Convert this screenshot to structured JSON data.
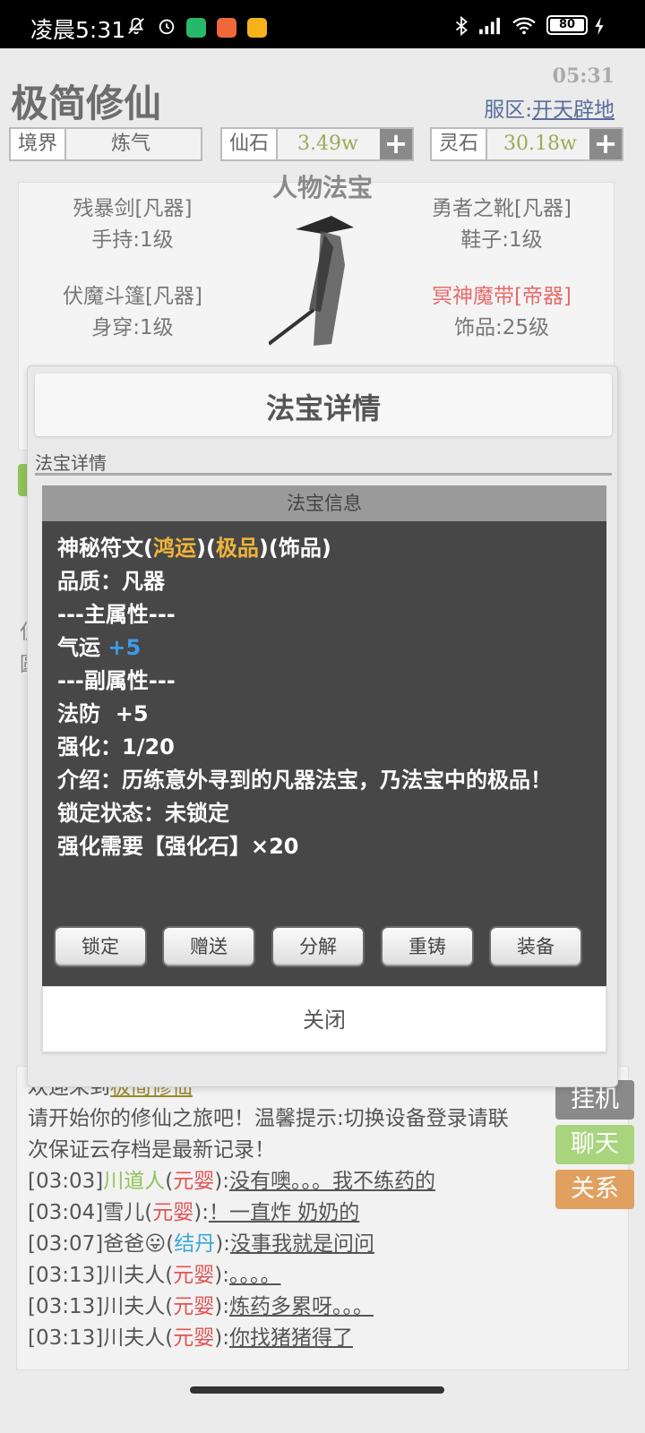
{
  "status_bar": {
    "time": "凌晨5:31",
    "battery": "80"
  },
  "header": {
    "app_title": "极简修仙",
    "clock": "05:31",
    "server_label": "服区:",
    "server_name": "开天辟地"
  },
  "stats": [
    {
      "label": "境界",
      "value": "炼气",
      "value_color": "#666666"
    },
    {
      "label": "仙石",
      "value": "3.49w",
      "value_color": "#a0a85a"
    },
    {
      "label": "灵石",
      "value": "30.18w",
      "value_color": "#a0a85a"
    }
  ],
  "equipment": {
    "title": "人物法宝",
    "slots": [
      {
        "name": "残暴剑[凡器]",
        "detail": "手持:1级"
      },
      {
        "name": "勇者之靴[凡器]",
        "detail": "鞋子:1级"
      },
      {
        "name": "伏魔斗篷[凡器]",
        "detail": "身穿:1级"
      },
      {
        "name": "冥神魔带[帝器]",
        "detail": "饰品:25级"
      }
    ],
    "bg_fragment_1": "仅",
    "bg_fragment_2": "圆"
  },
  "modal": {
    "title": "法宝详情",
    "subtitle": "法宝详情",
    "info_header": "法宝信息",
    "item": {
      "name": "神秘符文(",
      "tag1": "鸿运",
      "sep1": ")(",
      "tag2": "极品",
      "rest": ")(饰品)",
      "quality": "品质：凡器",
      "main_attr_header": "---主属性---",
      "main_attr_name": "气运",
      "main_attr_value": "+5",
      "sub_attr_header": "---副属性---",
      "sub_attr": "法防  +5",
      "enhance": "强化：1/20",
      "intro": "介绍：历练意外寻到的凡器法宝，乃法宝中的极品！",
      "lock_state": "锁定状态：未锁定",
      "enhance_need": "强化需要【强化石】×20"
    },
    "buttons": [
      "锁定",
      "赠送",
      "分解",
      "重铸",
      "装备"
    ],
    "close": "关闭"
  },
  "chat": {
    "welcome_prefix": "欢迎来到",
    "welcome_game": "极简修仙",
    "tip": "请开始你的修仙之旅吧！温馨提示:切换设备登录请联",
    "tip2": "次保证云存档是最新记录！",
    "messages": [
      {
        "time": "[03:03]",
        "user": "川道人",
        "user_class": "green",
        "realm": "元婴",
        "text": "没有噢。。。我不练药的"
      },
      {
        "time": "[03:04]",
        "user": "雪儿",
        "user_class": "",
        "realm": "元婴",
        "text": "！一直炸 奶奶的"
      },
      {
        "time": "[03:07]",
        "user": "爸爸😛",
        "user_class": "",
        "realm": "结丹",
        "text": "没事我就是问问"
      },
      {
        "time": "[03:13]",
        "user": "川夫人",
        "user_class": "",
        "realm": "元婴",
        "text": "。。。。"
      },
      {
        "time": "[03:13]",
        "user": "川夫人",
        "user_class": "",
        "realm": "元婴",
        "text": "炼药多累呀。。。"
      },
      {
        "time": "[03:13]",
        "user": "川夫人",
        "user_class": "",
        "realm": "元婴",
        "text": "你找猪猪得了"
      }
    ],
    "side_buttons": [
      {
        "label": "挂机",
        "color": "#8a8a8a"
      },
      {
        "label": "聊天",
        "color": "#a9d47e"
      },
      {
        "label": "关系",
        "color": "#e0a060"
      }
    ]
  }
}
